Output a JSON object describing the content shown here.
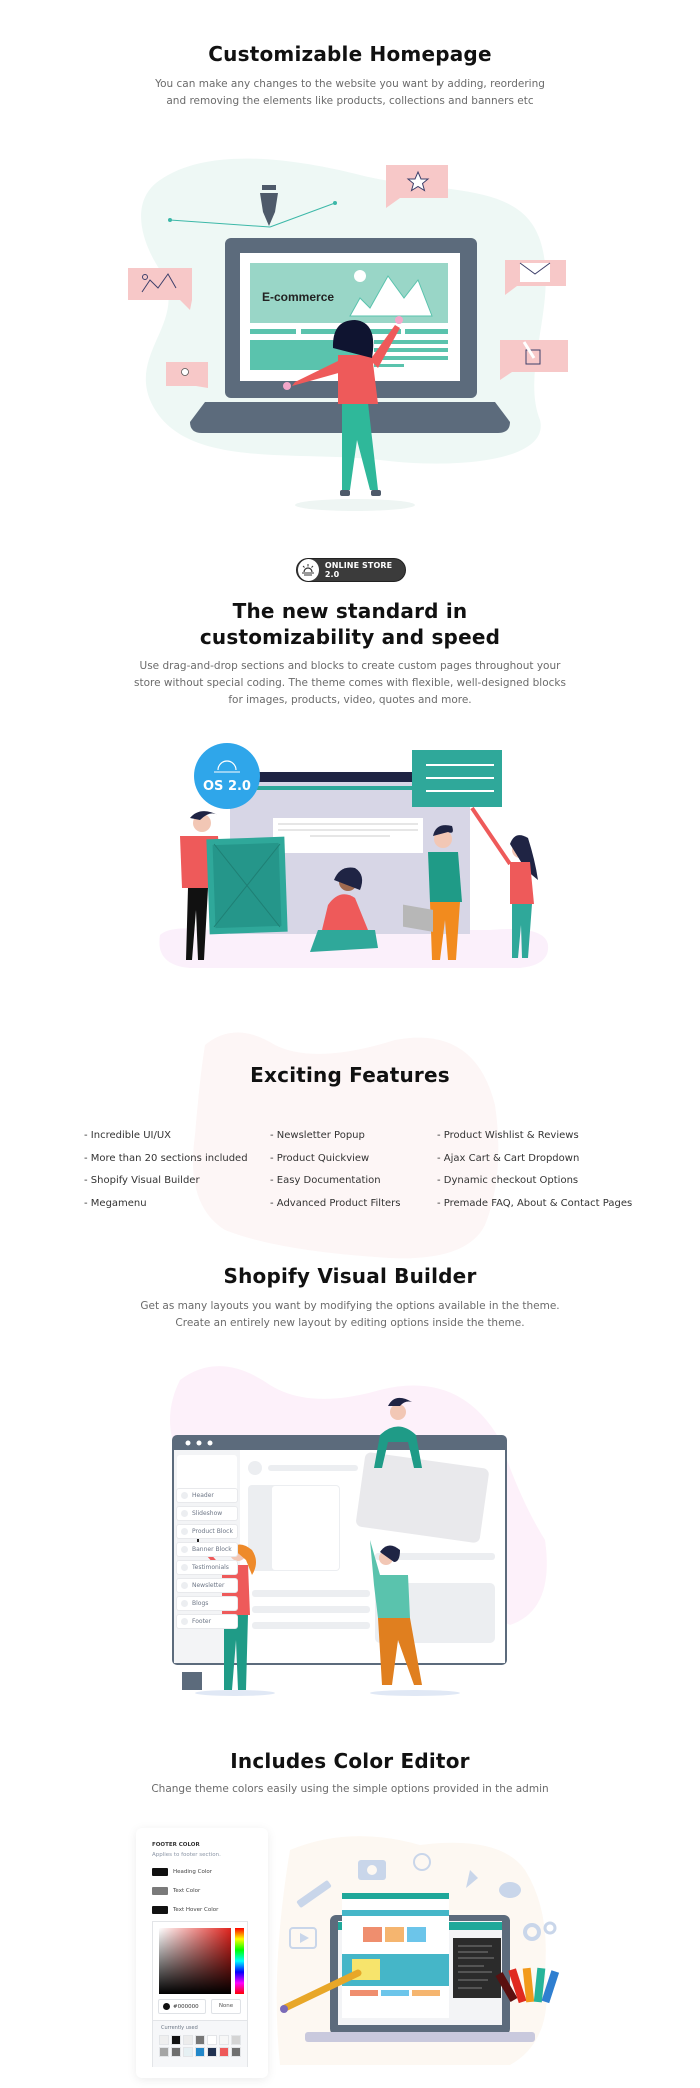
{
  "sections": {
    "homepage": {
      "title": "Customizable Homepage",
      "desc": [
        "You can make any changes to the website you want by adding, reordering",
        "and removing the elements like products, collections and banners etc"
      ],
      "illustration": {
        "screen_label": "E-commerce",
        "icons": [
          "pen-tool-icon",
          "star-icon",
          "mail-icon",
          "chart-icon",
          "location-pin-icon",
          "edit-icon"
        ]
      }
    },
    "online_store": {
      "badge": "ONLINE STORE 2.0",
      "title_lines": [
        "The new standard in",
        "customizability and speed"
      ],
      "desc": [
        "Use drag-and-drop sections and blocks to create custom pages throughout your",
        "store without special coding. The theme comes with flexible, well-designed blocks",
        "for images, products, video, quotes and more."
      ],
      "illustration": {
        "os_badge": "OS 2.0"
      }
    },
    "features": {
      "title": "Exciting Features",
      "columns": [
        [
          "- Incredible UI/UX",
          "- More than 20 sections included",
          "- Shopify Visual Builder",
          "- Megamenu"
        ],
        [
          "- Newsletter Popup",
          "- Product Quickview",
          "- Easy Documentation",
          "- Advanced Product Filters"
        ],
        [
          "- Product Wishlist & Reviews",
          "- Ajax Cart & Cart Dropdown",
          "- Dynamic checkout Options",
          "- Premade FAQ, About & Contact Pages"
        ]
      ]
    },
    "visual_builder": {
      "title": "Shopify Visual Builder",
      "desc": [
        "Get as many layouts you want by modifying the options available in the theme.",
        "Create an entirely new layout by editing options inside the theme."
      ],
      "sidebar_items": [
        "Header",
        "Slideshow",
        "Product Block",
        "Banner Block",
        "Testimonials",
        "Newsletter",
        "Blogs",
        "Footer"
      ]
    },
    "color_editor": {
      "title": "Includes Color Editor",
      "desc": "Change theme colors easily using the simple options provided in the admin",
      "panel": {
        "heading": "FOOTER COLOR",
        "subheading": "Applies to footer section.",
        "rows": [
          {
            "label": "Heading Color",
            "color": "#111111"
          },
          {
            "label": "Text Color",
            "color": "#7a7a7a"
          },
          {
            "label": "Text Hover Color",
            "color": "#111111"
          }
        ],
        "hex_value": "#000000",
        "none_label": "None",
        "used_label": "Currently used",
        "swatches": [
          "#efefef",
          "#111111",
          "#ececec",
          "#777777",
          "#ffffff",
          "#f7f7f7",
          "#d4d4d4",
          "#a5a5a5",
          "#6e6e6e",
          "#e6f0f3",
          "#2287c9",
          "#203150",
          "#ee5a5a",
          "#707070"
        ]
      }
    }
  },
  "colors": {
    "heading": "#111111",
    "body_text": "#6b6b6b",
    "teal": "#2fb89a",
    "coral": "#ee5a5a",
    "slate": "#5c6b7c"
  }
}
